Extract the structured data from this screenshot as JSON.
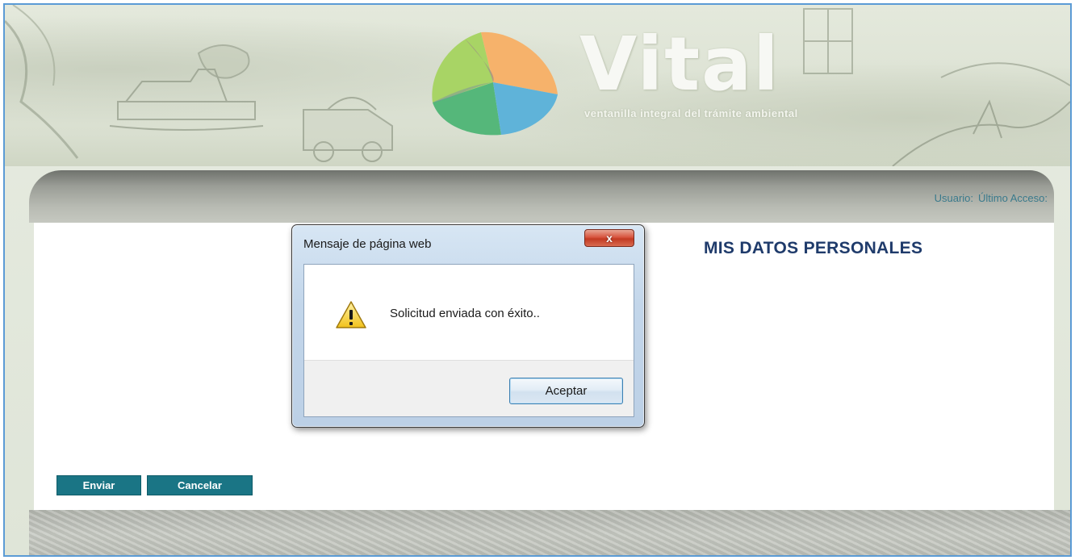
{
  "brand": {
    "title": "Vital",
    "subtitle": "ventanilla integral del trámite ambiental"
  },
  "header": {
    "usuario_label": "Usuario:",
    "ultimo_acceso_label": "Último Acceso:"
  },
  "main": {
    "page_title": "MIS DATOS PERSONALES",
    "buttons": {
      "enviar": "Enviar",
      "cancelar": "Cancelar"
    }
  },
  "dialog": {
    "title": "Mensaje de página web",
    "close_glyph": "x",
    "message": "Solicitud enviada con éxito..",
    "ok_label": "Aceptar",
    "icon": "warning-icon"
  },
  "colors": {
    "accent_button": "#1a7585",
    "title_color": "#1f3b6b",
    "user_info_color": "#3a7a8c"
  }
}
